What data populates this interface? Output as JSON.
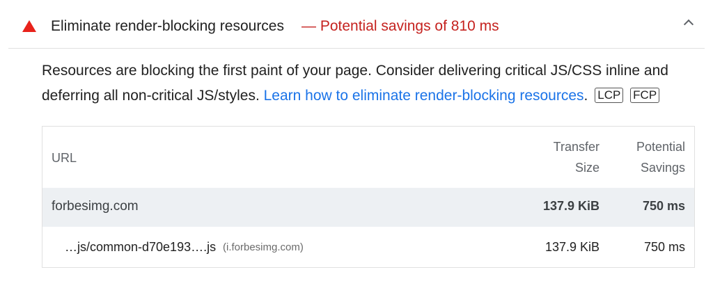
{
  "audit": {
    "title": "Eliminate render-blocking resources",
    "savings": "— Potential savings of 810 ms",
    "icon": "fail-triangle-icon",
    "status_color": "#e8221b",
    "savings_color": "#c5221f"
  },
  "description": {
    "text": "Resources are blocking the first paint of your page. Consider delivering critical JS/CSS inline and deferring all non-critical JS/styles. ",
    "link_text": "Learn how to eliminate render-blocking resources",
    "after_link": ".",
    "tags": [
      "LCP",
      "FCP"
    ],
    "link_color": "#1a73e8"
  },
  "table": {
    "headers": {
      "url": "URL",
      "size_line1": "Transfer",
      "size_line2": "Size",
      "savings_line1": "Potential",
      "savings_line2": "Savings"
    },
    "group": {
      "name": "forbesimg.com",
      "size": "137.9 KiB",
      "savings": "750 ms"
    },
    "items": [
      {
        "url": "…js/common-d70e193….js",
        "host": "(i.forbesimg.com)",
        "size": "137.9 KiB",
        "savings": "750 ms"
      }
    ]
  }
}
